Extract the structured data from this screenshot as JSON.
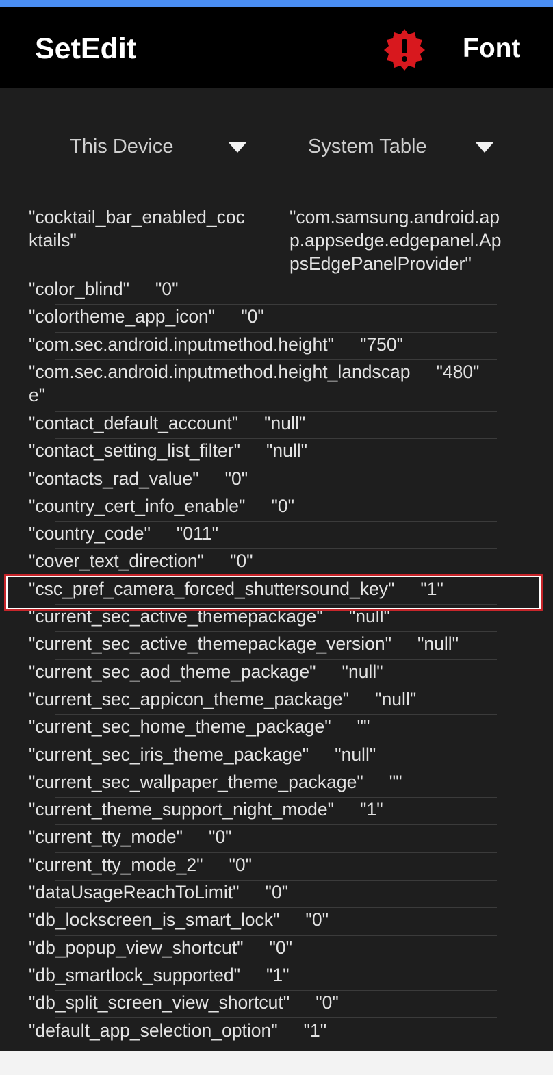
{
  "toolbar": {
    "title": "SetEdit",
    "font_label": "Font",
    "alert_icon": "alert-badge-icon",
    "alert_color": "#d8181e"
  },
  "spinners": {
    "device": "This Device",
    "table": "System Table"
  },
  "rows": [
    {
      "key_lines": [
        "\"cocktail_bar_enabled_coc",
        "ktails\""
      ],
      "value_lines": [
        "\"com.samsung.android.ap",
        "p.appsedge.edgepanel.Ap",
        "psEdgePanelProvider\""
      ]
    },
    {
      "key": "\"color_blind\"",
      "value": "\"0\""
    },
    {
      "key": "\"colortheme_app_icon\"",
      "value": "\"0\""
    },
    {
      "key": "\"com.sec.android.inputmethod.height\"",
      "value": "\"750\""
    },
    {
      "key_lines": [
        "\"com.sec.android.inputmethod.height_landscap",
        "e\""
      ],
      "value": "\"480\""
    },
    {
      "key": "\"contact_default_account\"",
      "value": "\"null\""
    },
    {
      "key": "\"contact_setting_list_filter\"",
      "value": "\"null\""
    },
    {
      "key": "\"contacts_rad_value\"",
      "value": "\"0\""
    },
    {
      "key": "\"country_cert_info_enable\"",
      "value": "\"0\""
    },
    {
      "key": "\"country_code\"",
      "value": "\"011\""
    },
    {
      "key": "\"cover_text_direction\"",
      "value": "\"0\""
    },
    {
      "key": "\"csc_pref_camera_forced_shuttersound_key\"",
      "value": "\"1\""
    },
    {
      "key": "\"current_sec_active_themepackage\"",
      "value": "\"null\""
    },
    {
      "key": "\"current_sec_active_themepackage_version\"",
      "value": "\"null\""
    },
    {
      "key": "\"current_sec_aod_theme_package\"",
      "value": "\"null\""
    },
    {
      "key": "\"current_sec_appicon_theme_package\"",
      "value": "\"null\""
    },
    {
      "key": "\"current_sec_home_theme_package\"",
      "value": "\"\""
    },
    {
      "key": "\"current_sec_iris_theme_package\"",
      "value": "\"null\""
    },
    {
      "key": "\"current_sec_wallpaper_theme_package\"",
      "value": "\"\""
    },
    {
      "key": "\"current_theme_support_night_mode\"",
      "value": "\"1\""
    },
    {
      "key": "\"current_tty_mode\"",
      "value": "\"0\""
    },
    {
      "key": "\"current_tty_mode_2\"",
      "value": "\"0\""
    },
    {
      "key": "\"dataUsageReachToLimit\"",
      "value": "\"0\""
    },
    {
      "key": "\"db_lockscreen_is_smart_lock\"",
      "value": "\"0\""
    },
    {
      "key": "\"db_popup_view_shortcut\"",
      "value": "\"0\""
    },
    {
      "key": "\"db_smartlock_supported\"",
      "value": "\"1\""
    },
    {
      "key": "\"db_split_screen_view_shortcut\"",
      "value": "\"0\""
    },
    {
      "key": "\"default_app_selection_option\"",
      "value": "\"1\""
    }
  ],
  "highlight_color": "#c7262b"
}
